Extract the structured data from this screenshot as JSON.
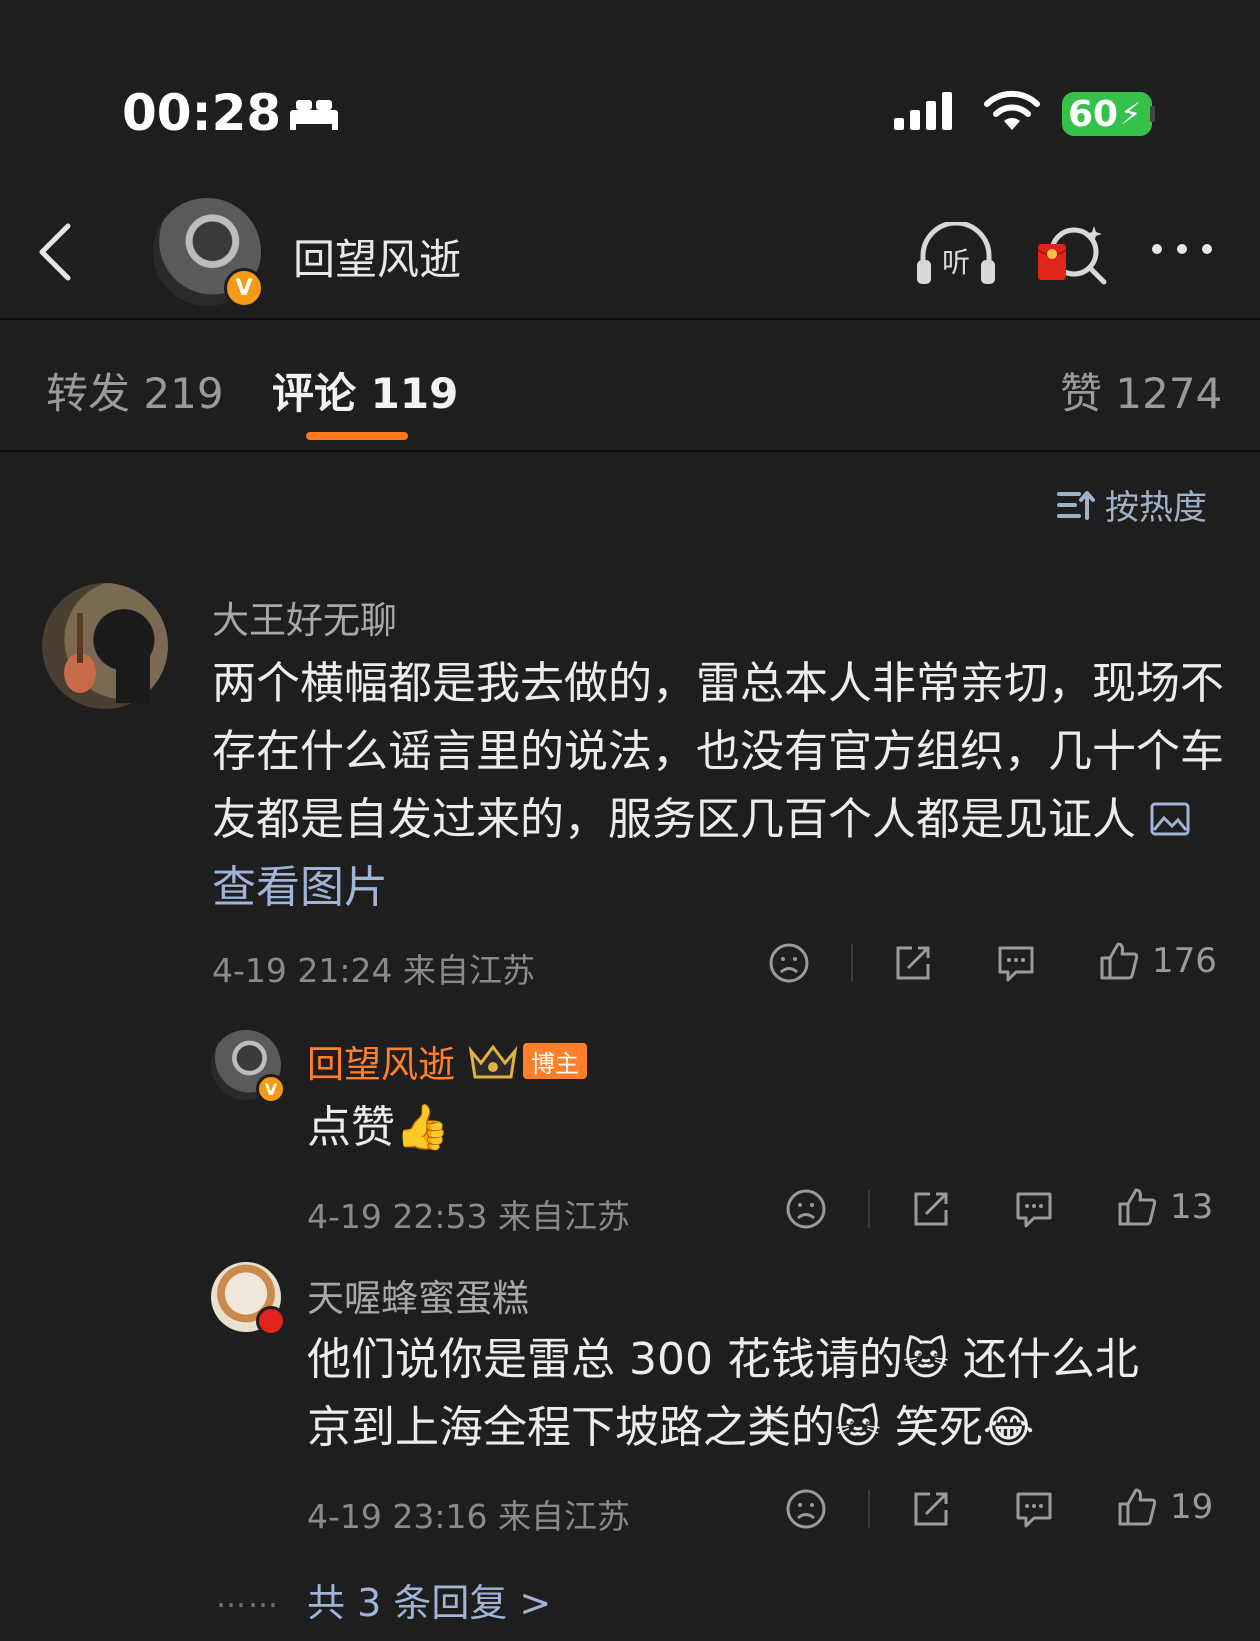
{
  "status_bar": {
    "time": "00:28",
    "battery": "60"
  },
  "header": {
    "title": "回望风逝",
    "verified_badge": "V"
  },
  "tabs": [
    {
      "label": "转发",
      "count": "219"
    },
    {
      "label": "评论",
      "count": "119"
    },
    {
      "label": "赞",
      "count": "1274"
    }
  ],
  "sort": {
    "label": "按热度"
  },
  "comments": [
    {
      "user": "大王好无聊",
      "text": "两个横幅都是我去做的，雷总本人非常亲切，现场不存在什么谣言里的说法，也没有官方组织，几十个车友都是自发过来的，服务区几百个人都是见证人",
      "link": "查看图片",
      "time": "4-19 21:24",
      "location": "来自江苏",
      "likes": "176",
      "replies": [
        {
          "user": "回望风逝",
          "badge": "博主",
          "text": "点赞",
          "emoji": "👍",
          "time": "4-19 22:53",
          "location": "来自江苏",
          "likes": "13"
        },
        {
          "user": "天喔蜂蜜蛋糕",
          "text_1": "他们说你是雷总 300 花钱请的",
          "emoji_1": "🐱",
          "text_2": "还什么北",
          "text_3": "京到上海全程下坡路之类的",
          "emoji_2": "🐱",
          "text_4": "笑死",
          "emoji_3": "😂",
          "time": "4-19 23:16",
          "location": "来自江苏",
          "likes": "19"
        }
      ],
      "more_replies": "共 3 条回复 >"
    }
  ]
}
